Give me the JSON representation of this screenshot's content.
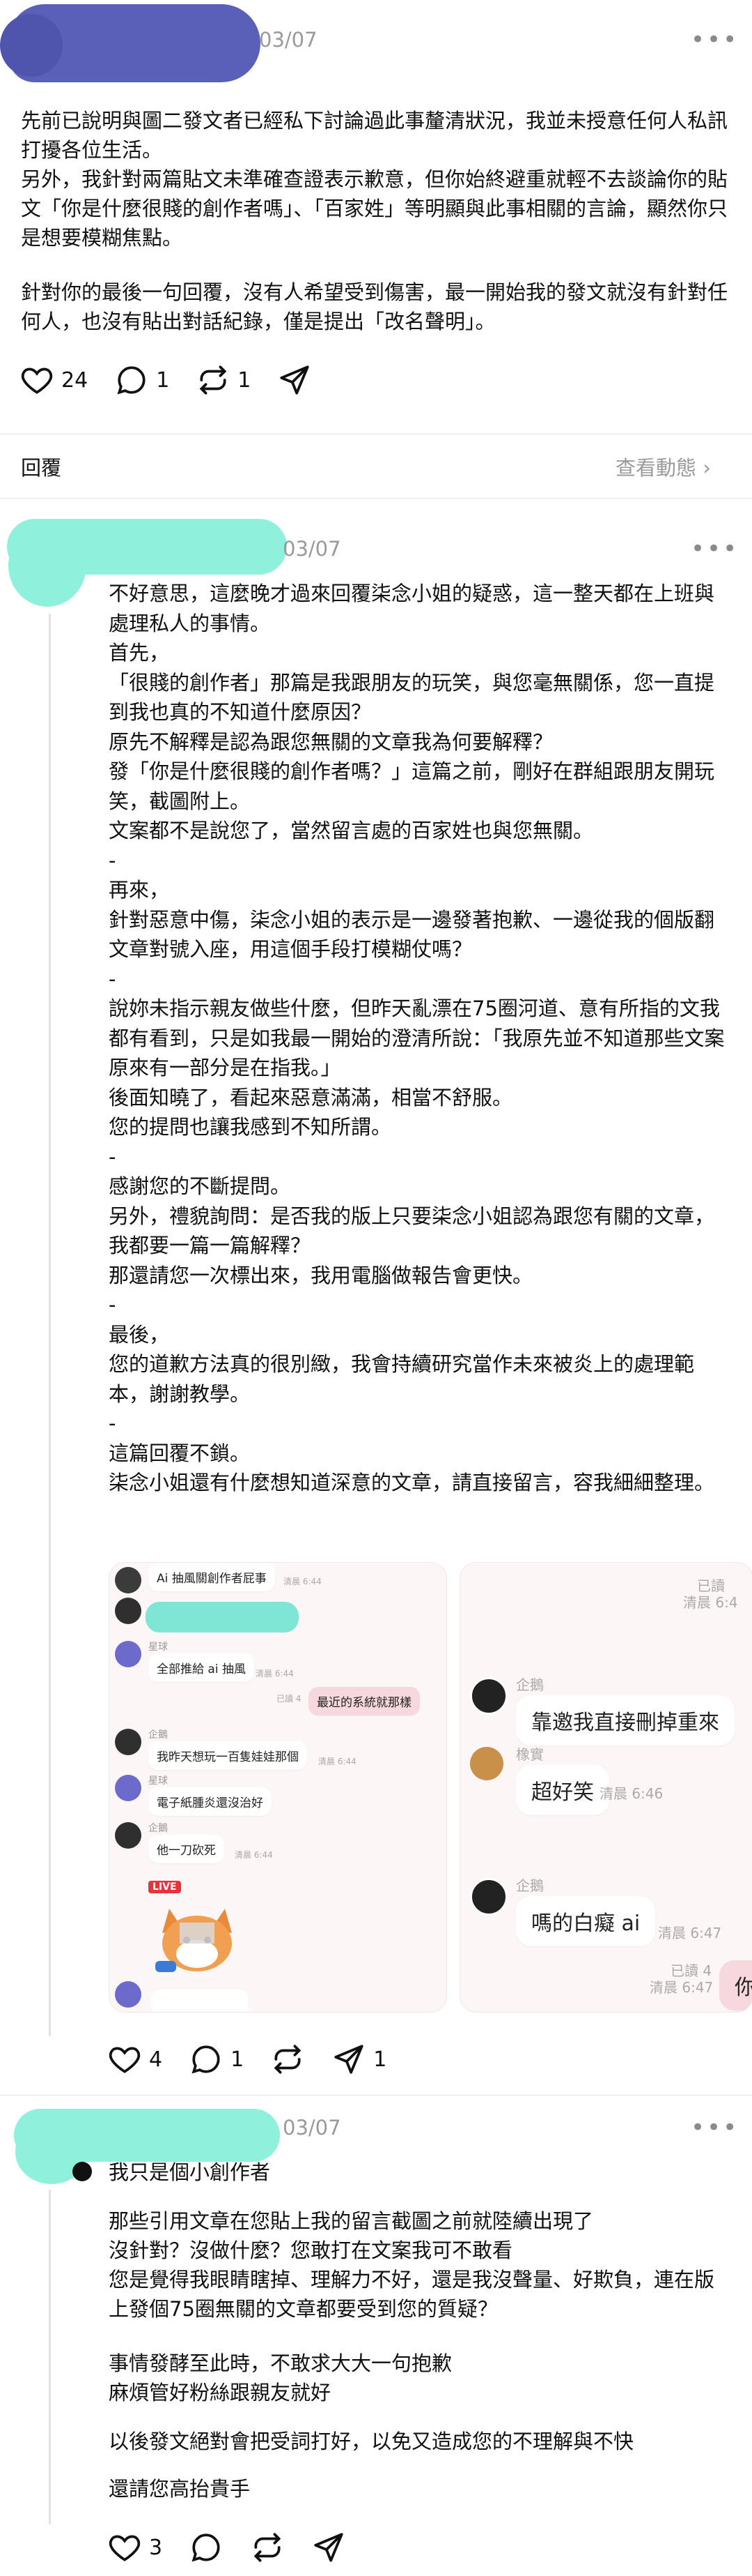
{
  "post1": {
    "date": "03/07",
    "more": "•••",
    "text": "先前已說明與圖二發文者已經私下討論過此事釐清狀況，我並未授意任何人私訊打擾各位生活。\n另外，我針對兩篇貼文未準確查證表示歉意，但你始終避重就輕不去談論你的貼文「你是什麼很賤的創作者嗎」、「百家姓」等明顯與此事相關的言論，顯然你只是想要模糊焦點。",
    "text2": "針對你的最後一句回覆，沒有人希望受到傷害，最一開始我的發文就沒有針對任何人，也沒有貼出對話紀錄，僅是提出「改名聲明」。",
    "likes": "24",
    "replies": "1",
    "reposts": "1"
  },
  "reply_bar": {
    "label": "回覆",
    "view_activity": "查看動態 ›"
  },
  "post2": {
    "date": "03/07",
    "more": "•••",
    "text": "不好意思，這麼晚才過來回覆柒念小姐的疑惑，這一整天都在上班與處理私人的事情。\n首先，\n「很賤的創作者」那篇是我跟朋友的玩笑，與您毫無關係，您一直提到我也真的不知道什麼原因？\n原先不解釋是認為跟您無關的文章我為何要解釋？\n發「你是什麼很賤的創作者嗎？」這篇之前，剛好在群組跟朋友開玩笑，截圖附上。\n文案都不是說您了，當然留言處的百家姓也與您無關。\n-\n再來，\n針對惡意中傷，柒念小姐的表示是一邊發著抱歉、一邊從我的個版翻文章對號入座，用這個手段打模糊仗嗎？\n-\n說妳未指示親友做些什麼，但昨天亂漂在75圈河道、意有所指的文我都有看到，只是如我最一開始的澄清所說：「我原先並不知道那些文案原來有一部分是在指我。」\n後面知曉了，看起來惡意滿滿，相當不舒服。\n您的提問也讓我感到不知所謂。\n-\n感謝您的不斷提問。\n另外，禮貌詢問：是否我的版上只要柒念小姐認為跟您有關的文章，我都要一篇一篇解釋？\n那還請您一次標出來，我用電腦做報告會更快。\n-\n最後，\n您的道歉方法真的很別緻，我會持續研究當作未來被炎上的處理範本，謝謝教學。\n-\n這篇回覆不鎖。\n柒念小姐還有什麼想知道深意的文章，請直接留言，容我細細整理。",
    "likes": "4",
    "replies": "1",
    "reposts": "",
    "shares": "1",
    "shot1": {
      "top_msg": "Ai 抽風關創作者屁事",
      "m1": "全部推給 ai 抽風",
      "m2": "最近的系統就那樣",
      "m3": "我昨天想玩一百隻娃娃那個",
      "m4": "電子紙腫炎還沒治好",
      "m5": "他一刀砍死",
      "live": "LIVE",
      "read": "已讀 4",
      "time": "清晨 6:44",
      "name_a": "企鵝",
      "name_b": "星球"
    },
    "shot2": {
      "read_top": "已讀",
      "time_top": "清晨 6:4",
      "n1": "企鵝",
      "b1": "靠邀我直接刪掉重來",
      "n2": "橡實",
      "b2": "超好笑",
      "t2": "清晨 6:46",
      "n3": "企鵝",
      "b3": "嗎的白癡 ai",
      "t3": "清晨 6:47",
      "read3": "已讀 4",
      "t4": "清晨 6:47",
      "b4": "你"
    }
  },
  "post3": {
    "date": "03/07",
    "more": "•••",
    "text1": "我只是個小創作者",
    "text2": "那些引用文章在您貼上我的留言截圖之前就陸續出現了\n沒針對？沒做什麼？您敢打在文案我可不敢看\n您是覺得我眼睛瞎掉、理解力不好，還是我沒聲量、好欺負，連在版上發個75圈無關的文章都要受到您的質疑？",
    "text3": "事情發酵至此時，不敢求大大一句抱歉\n麻煩管好粉絲跟親友就好",
    "text4": "以後發文絕對會把受詞打好，以免又造成您的不理解與不快",
    "text5": "還請您高抬貴手",
    "likes": "3"
  },
  "colors": {
    "redact_purple": "#5a5fb8",
    "redact_teal": "#8ff0dc",
    "text": "#111111",
    "muted": "#9a9a9a"
  }
}
